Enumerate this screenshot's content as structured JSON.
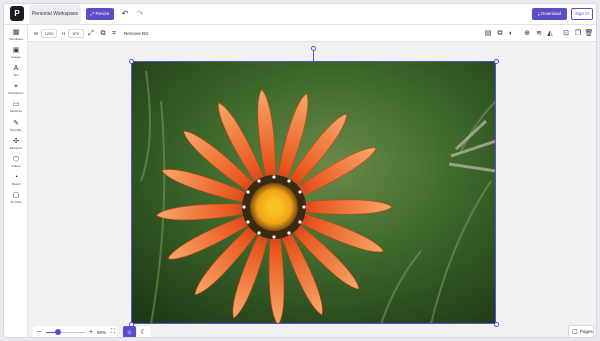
{
  "app": {
    "logo_text": "P",
    "workspace_label": "Personal Workspace",
    "resize_label": "Resize",
    "undo_icon": "↶",
    "redo_icon": "↷",
    "download_label": "Download",
    "signin_label": "Sign In",
    "accent_color": "#5b4fc7"
  },
  "sidebar": {
    "items": [
      {
        "label": "Templates",
        "icon": "templates-icon",
        "glyph": "▦"
      },
      {
        "label": "Images",
        "icon": "image-icon",
        "glyph": "▣"
      },
      {
        "label": "Text",
        "icon": "text-icon",
        "glyph": "A"
      },
      {
        "label": "Illustrations",
        "icon": "illustrations-icon",
        "glyph": "⌖"
      },
      {
        "label": "Mockups",
        "icon": "mockups-icon",
        "glyph": "▭"
      },
      {
        "label": "Brandify",
        "icon": "brandify-icon",
        "glyph": "✎"
      },
      {
        "label": "Elements",
        "icon": "elements-icon",
        "glyph": "✣"
      },
      {
        "label": "Cubes",
        "icon": "cubes-icon",
        "glyph": "⬡"
      },
      {
        "label": "Brand",
        "icon": "brand-icon",
        "glyph": "◔"
      },
      {
        "label": "My Files",
        "icon": "folder-icon",
        "glyph": "▢"
      }
    ]
  },
  "toolbar": {
    "w_label": "W",
    "w_value": "1200",
    "h_label": "H",
    "h_value": "870",
    "remove_bg_label": "Remove BG"
  },
  "zoom": {
    "value_label": "86%",
    "level": 0.3
  },
  "pages_label": "Pages"
}
